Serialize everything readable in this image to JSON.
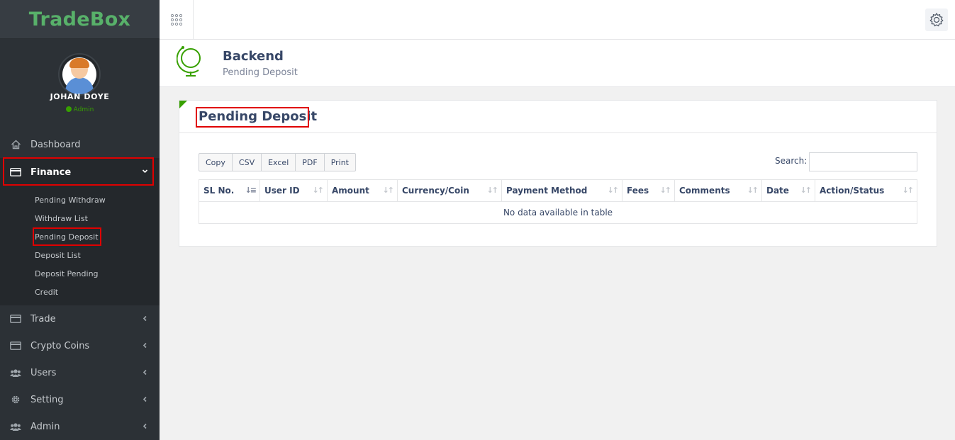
{
  "brand": "TradeBox",
  "user": {
    "name": "JOHAN DOYE",
    "role": "Admin"
  },
  "menu": {
    "dashboard": "Dashboard",
    "finance": "Finance",
    "finance_sub": [
      "Pending Withdraw",
      "Withdraw List",
      "Pending Deposit",
      "Deposit List",
      "Deposit Pending",
      "Credit"
    ],
    "trade": "Trade",
    "crypto": "Crypto Coins",
    "users": "Users",
    "setting": "Setting",
    "admin": "Admin"
  },
  "header": {
    "title": "Backend",
    "subtitle": "Pending Deposit"
  },
  "panel": {
    "title": "Pending Deposit",
    "buttons": [
      "Copy",
      "CSV",
      "Excel",
      "PDF",
      "Print"
    ],
    "search_label": "Search:",
    "columns": [
      "SL No.",
      "User ID",
      "Amount",
      "Currency/Coin",
      "Payment Method",
      "Fees",
      "Comments",
      "Date",
      "Action/Status"
    ],
    "empty_text": "No data available in table"
  },
  "colors": {
    "accent": "#37a000",
    "brand": "#58b16a",
    "sidebar": "#2c3136",
    "highlight": "#e00000"
  }
}
